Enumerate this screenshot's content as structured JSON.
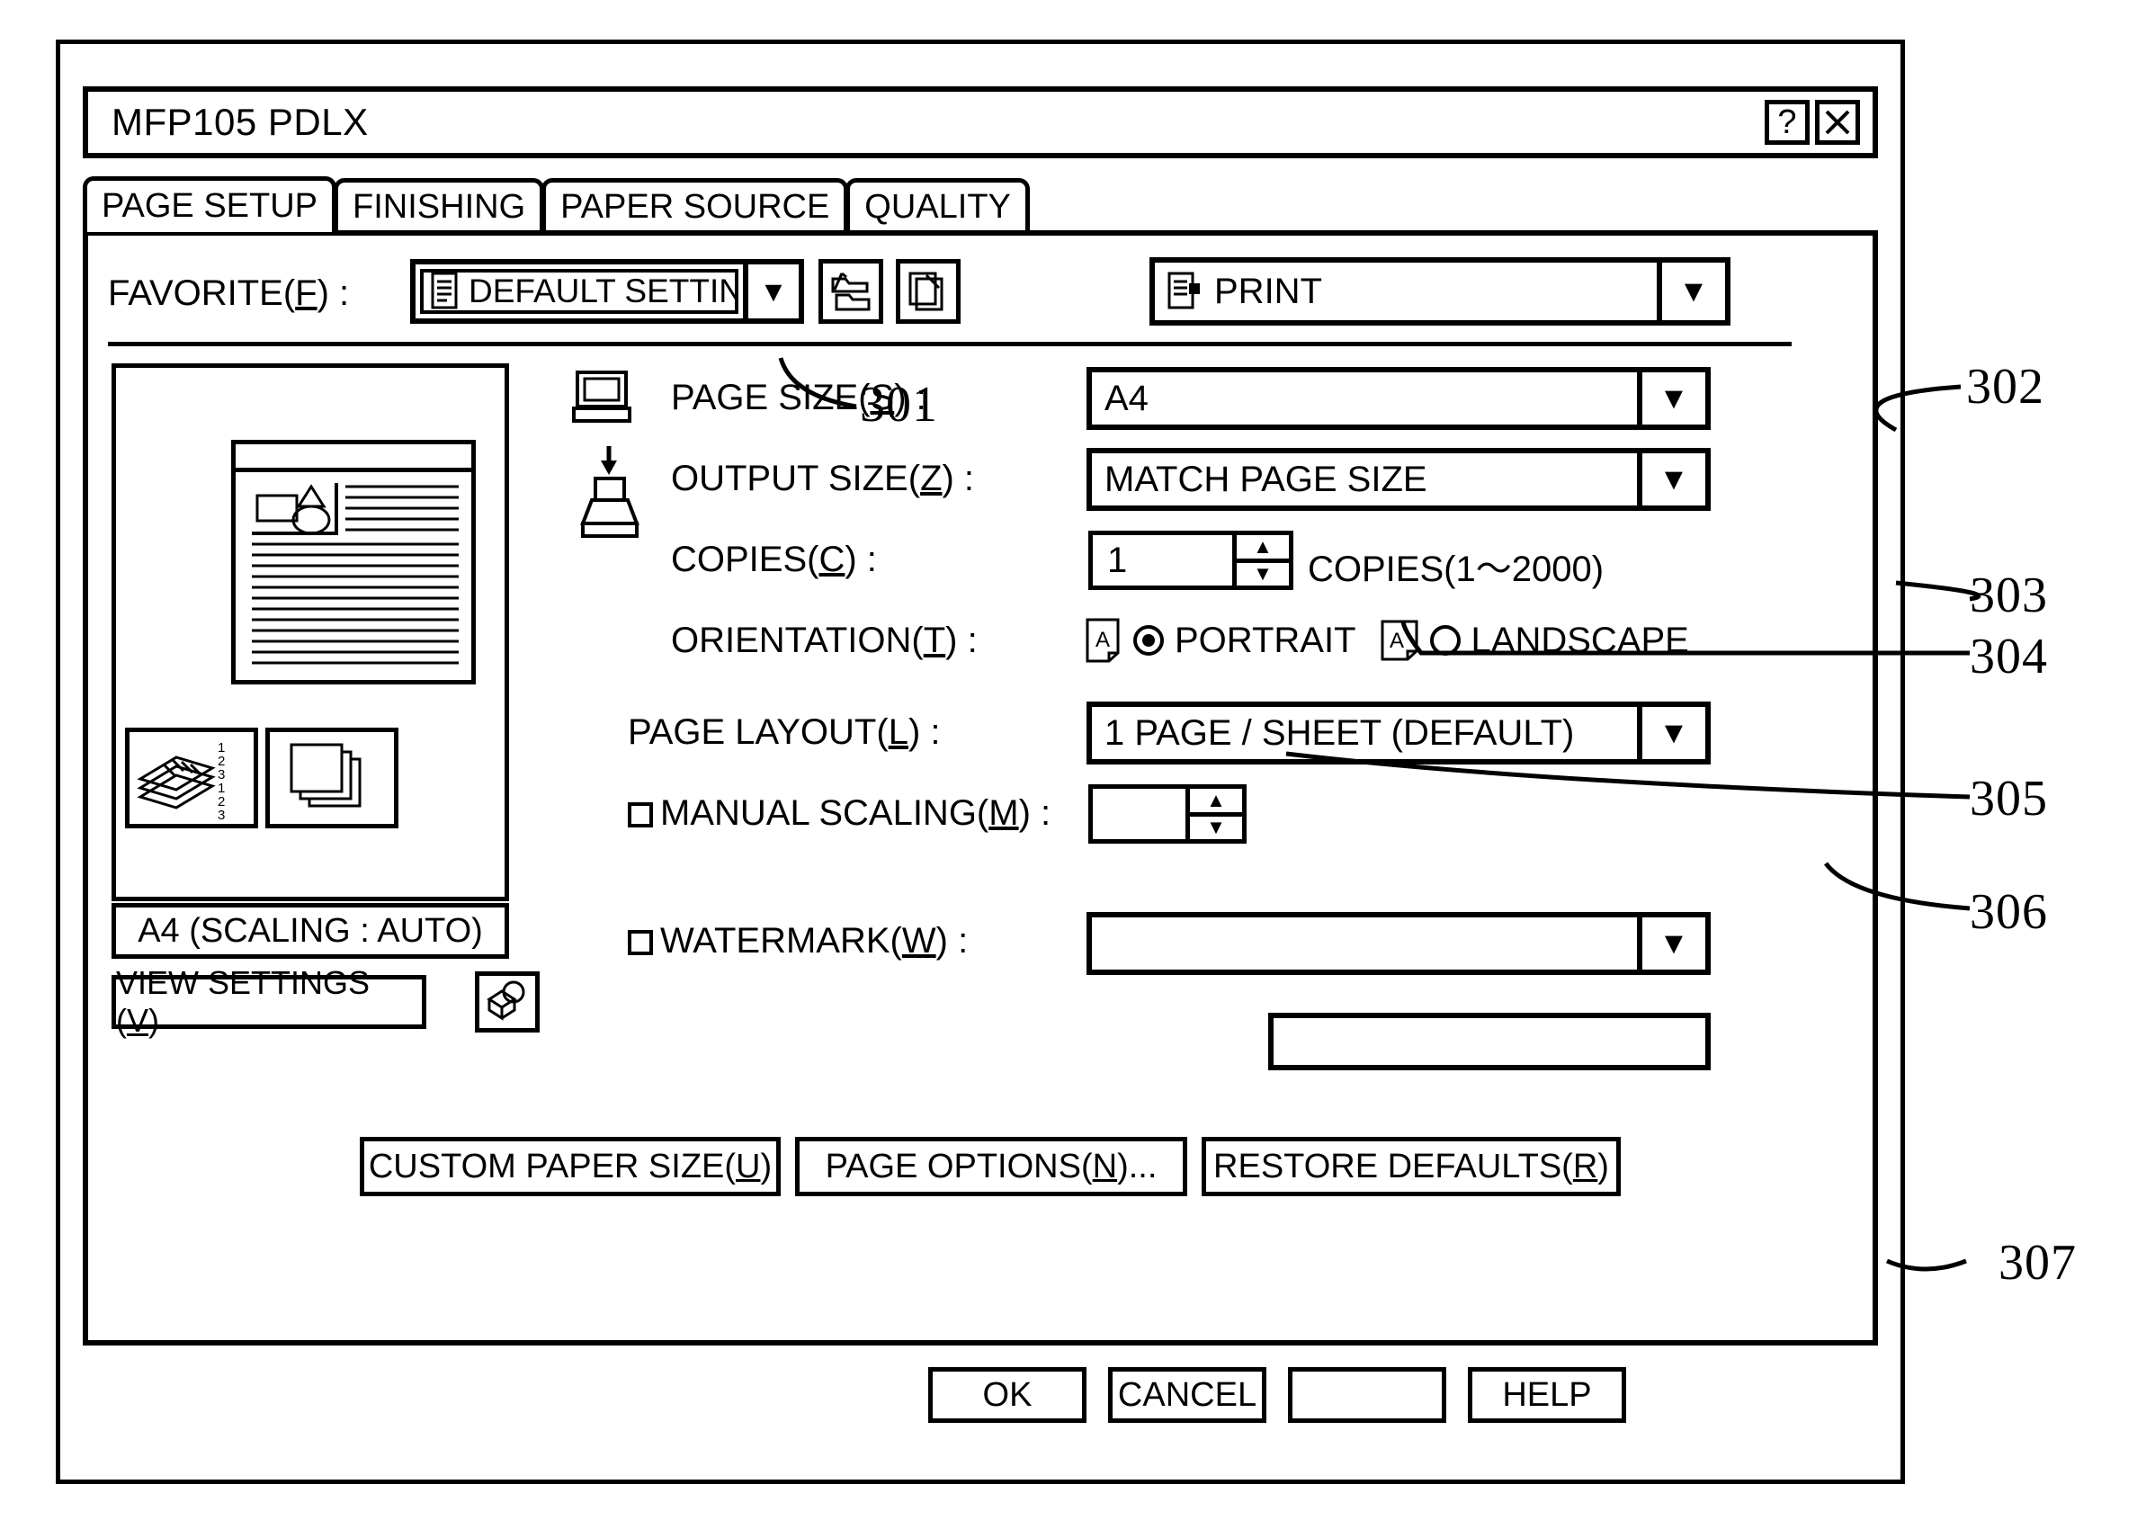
{
  "figure": {
    "reference_numerals": [
      {
        "id": "301",
        "label": "301"
      },
      {
        "id": "302",
        "label": "302"
      },
      {
        "id": "303",
        "label": "303"
      },
      {
        "id": "304",
        "label": "304"
      },
      {
        "id": "305",
        "label": "305"
      },
      {
        "id": "306",
        "label": "306"
      },
      {
        "id": "307",
        "label": "307"
      }
    ]
  },
  "window": {
    "title": "MFP105 PDLX",
    "help_button": "?",
    "close_button": "✕"
  },
  "tabs": [
    {
      "label": "PAGE SETUP",
      "active": true
    },
    {
      "label": "FINISHING",
      "active": false
    },
    {
      "label": "PAPER SOURCE",
      "active": false
    },
    {
      "label": "QUALITY",
      "active": false
    }
  ],
  "favorite": {
    "label": "FAVORITE(F) :",
    "label_pre": "FAVORITE(",
    "accel": "F",
    "label_post": ") :",
    "value": "DEFAULT SETTINGS",
    "icon": "document-list-icon",
    "dropdown_arrow": "▼",
    "save_button_icon": "folder-save-icon",
    "load_button_icon": "copy-pages-icon"
  },
  "job_mode": {
    "value": "PRINT",
    "icon": "print-document-icon",
    "dropdown_arrow": "▼"
  },
  "preview": {
    "caption": "A4 (SCALING : AUTO)",
    "page_icon": "document-page-preview",
    "thumb_collate_icon": "collate-stack-icon",
    "thumb_collate_numbers": [
      "1",
      "2",
      "3",
      "1",
      "2",
      "3"
    ],
    "thumb_group_icon": "stacked-sheets-icon",
    "view_settings_pre": "VIEW SETTINGS (",
    "view_settings_accel": "V",
    "view_settings_post": ")",
    "watermark_icon": "cube-sphere-icon"
  },
  "fields": {
    "page_size": {
      "label_pre": "PAGE SIZE(",
      "accel": "S",
      "label_post": ") :",
      "value": "A4",
      "arrow": "▼",
      "icon": "monitor-icon"
    },
    "output_size": {
      "label_pre": "OUTPUT SIZE(",
      "accel": "Z",
      "label_post": ") :",
      "value": "MATCH PAGE SIZE",
      "arrow": "▼",
      "icon": "printer-icon"
    },
    "copies": {
      "label_pre": "COPIES(",
      "accel": "C",
      "label_post": ") :",
      "value": "1",
      "hint": "COPIES(1～2000)",
      "up_arrow": "▲",
      "down_arrow": "▼"
    },
    "orientation": {
      "label_pre": "ORIENTATION(",
      "accel": "T",
      "label_post": ") :",
      "portrait_label": "PORTRAIT",
      "landscape_label": "LANDSCAPE",
      "selected": "PORTRAIT",
      "portrait_icon": "portrait-page-icon",
      "landscape_icon": "landscape-page-icon"
    },
    "page_layout": {
      "label_pre": "PAGE LAYOUT(",
      "accel": "L",
      "label_post": ") :",
      "value": "1 PAGE / SHEET (DEFAULT)",
      "arrow": "▼"
    },
    "manual_scaling": {
      "label_pre": "MANUAL SCALING(",
      "accel": "M",
      "label_post": ") :",
      "checked": false,
      "value": "",
      "up_arrow": "▲",
      "down_arrow": "▼"
    },
    "watermark": {
      "label_pre": "WATERMARK(",
      "accel": "W",
      "label_post": ") :",
      "checked": false,
      "value": "",
      "arrow": "▼"
    },
    "extra_field": {
      "value": ""
    }
  },
  "action_buttons": [
    {
      "pre": "CUSTOM PAPER SIZE(",
      "accel": "U",
      "post": ")"
    },
    {
      "pre": "PAGE OPTIONS(",
      "accel": "N",
      "post": ")..."
    },
    {
      "pre": "RESTORE DEFAULTS(",
      "accel": "R",
      "post": ")"
    }
  ],
  "footer_buttons": [
    {
      "label": "OK"
    },
    {
      "label": "CANCEL"
    },
    {
      "label": ""
    },
    {
      "label": "HELP"
    }
  ]
}
